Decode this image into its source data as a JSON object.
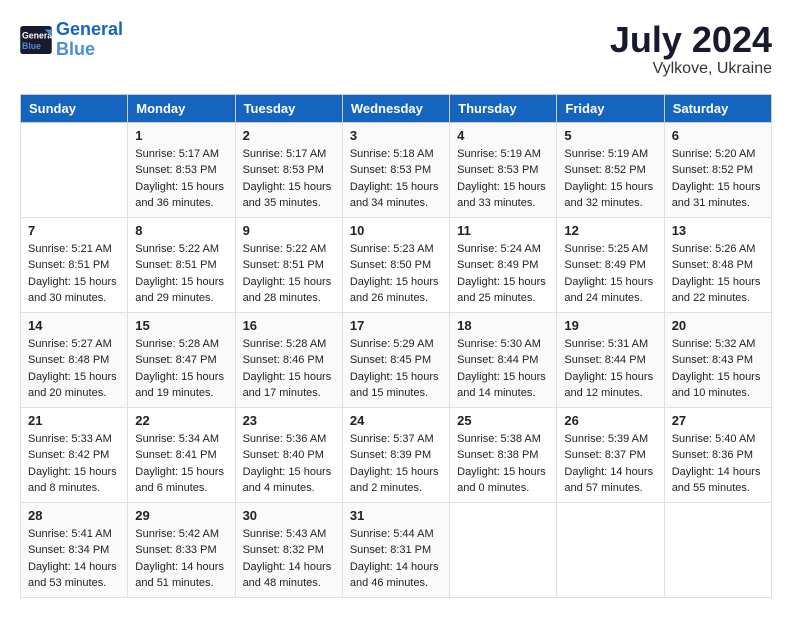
{
  "header": {
    "logo_line1": "General",
    "logo_line2": "Blue",
    "month": "July 2024",
    "location": "Vylkove, Ukraine"
  },
  "weekdays": [
    "Sunday",
    "Monday",
    "Tuesday",
    "Wednesday",
    "Thursday",
    "Friday",
    "Saturday"
  ],
  "weeks": [
    [
      {
        "day": "",
        "sunrise": "",
        "sunset": "",
        "daylight": ""
      },
      {
        "day": "1",
        "sunrise": "Sunrise: 5:17 AM",
        "sunset": "Sunset: 8:53 PM",
        "daylight": "Daylight: 15 hours and 36 minutes."
      },
      {
        "day": "2",
        "sunrise": "Sunrise: 5:17 AM",
        "sunset": "Sunset: 8:53 PM",
        "daylight": "Daylight: 15 hours and 35 minutes."
      },
      {
        "day": "3",
        "sunrise": "Sunrise: 5:18 AM",
        "sunset": "Sunset: 8:53 PM",
        "daylight": "Daylight: 15 hours and 34 minutes."
      },
      {
        "day": "4",
        "sunrise": "Sunrise: 5:19 AM",
        "sunset": "Sunset: 8:53 PM",
        "daylight": "Daylight: 15 hours and 33 minutes."
      },
      {
        "day": "5",
        "sunrise": "Sunrise: 5:19 AM",
        "sunset": "Sunset: 8:52 PM",
        "daylight": "Daylight: 15 hours and 32 minutes."
      },
      {
        "day": "6",
        "sunrise": "Sunrise: 5:20 AM",
        "sunset": "Sunset: 8:52 PM",
        "daylight": "Daylight: 15 hours and 31 minutes."
      }
    ],
    [
      {
        "day": "7",
        "sunrise": "Sunrise: 5:21 AM",
        "sunset": "Sunset: 8:51 PM",
        "daylight": "Daylight: 15 hours and 30 minutes."
      },
      {
        "day": "8",
        "sunrise": "Sunrise: 5:22 AM",
        "sunset": "Sunset: 8:51 PM",
        "daylight": "Daylight: 15 hours and 29 minutes."
      },
      {
        "day": "9",
        "sunrise": "Sunrise: 5:22 AM",
        "sunset": "Sunset: 8:51 PM",
        "daylight": "Daylight: 15 hours and 28 minutes."
      },
      {
        "day": "10",
        "sunrise": "Sunrise: 5:23 AM",
        "sunset": "Sunset: 8:50 PM",
        "daylight": "Daylight: 15 hours and 26 minutes."
      },
      {
        "day": "11",
        "sunrise": "Sunrise: 5:24 AM",
        "sunset": "Sunset: 8:49 PM",
        "daylight": "Daylight: 15 hours and 25 minutes."
      },
      {
        "day": "12",
        "sunrise": "Sunrise: 5:25 AM",
        "sunset": "Sunset: 8:49 PM",
        "daylight": "Daylight: 15 hours and 24 minutes."
      },
      {
        "day": "13",
        "sunrise": "Sunrise: 5:26 AM",
        "sunset": "Sunset: 8:48 PM",
        "daylight": "Daylight: 15 hours and 22 minutes."
      }
    ],
    [
      {
        "day": "14",
        "sunrise": "Sunrise: 5:27 AM",
        "sunset": "Sunset: 8:48 PM",
        "daylight": "Daylight: 15 hours and 20 minutes."
      },
      {
        "day": "15",
        "sunrise": "Sunrise: 5:28 AM",
        "sunset": "Sunset: 8:47 PM",
        "daylight": "Daylight: 15 hours and 19 minutes."
      },
      {
        "day": "16",
        "sunrise": "Sunrise: 5:28 AM",
        "sunset": "Sunset: 8:46 PM",
        "daylight": "Daylight: 15 hours and 17 minutes."
      },
      {
        "day": "17",
        "sunrise": "Sunrise: 5:29 AM",
        "sunset": "Sunset: 8:45 PM",
        "daylight": "Daylight: 15 hours and 15 minutes."
      },
      {
        "day": "18",
        "sunrise": "Sunrise: 5:30 AM",
        "sunset": "Sunset: 8:44 PM",
        "daylight": "Daylight: 15 hours and 14 minutes."
      },
      {
        "day": "19",
        "sunrise": "Sunrise: 5:31 AM",
        "sunset": "Sunset: 8:44 PM",
        "daylight": "Daylight: 15 hours and 12 minutes."
      },
      {
        "day": "20",
        "sunrise": "Sunrise: 5:32 AM",
        "sunset": "Sunset: 8:43 PM",
        "daylight": "Daylight: 15 hours and 10 minutes."
      }
    ],
    [
      {
        "day": "21",
        "sunrise": "Sunrise: 5:33 AM",
        "sunset": "Sunset: 8:42 PM",
        "daylight": "Daylight: 15 hours and 8 minutes."
      },
      {
        "day": "22",
        "sunrise": "Sunrise: 5:34 AM",
        "sunset": "Sunset: 8:41 PM",
        "daylight": "Daylight: 15 hours and 6 minutes."
      },
      {
        "day": "23",
        "sunrise": "Sunrise: 5:36 AM",
        "sunset": "Sunset: 8:40 PM",
        "daylight": "Daylight: 15 hours and 4 minutes."
      },
      {
        "day": "24",
        "sunrise": "Sunrise: 5:37 AM",
        "sunset": "Sunset: 8:39 PM",
        "daylight": "Daylight: 15 hours and 2 minutes."
      },
      {
        "day": "25",
        "sunrise": "Sunrise: 5:38 AM",
        "sunset": "Sunset: 8:38 PM",
        "daylight": "Daylight: 15 hours and 0 minutes."
      },
      {
        "day": "26",
        "sunrise": "Sunrise: 5:39 AM",
        "sunset": "Sunset: 8:37 PM",
        "daylight": "Daylight: 14 hours and 57 minutes."
      },
      {
        "day": "27",
        "sunrise": "Sunrise: 5:40 AM",
        "sunset": "Sunset: 8:36 PM",
        "daylight": "Daylight: 14 hours and 55 minutes."
      }
    ],
    [
      {
        "day": "28",
        "sunrise": "Sunrise: 5:41 AM",
        "sunset": "Sunset: 8:34 PM",
        "daylight": "Daylight: 14 hours and 53 minutes."
      },
      {
        "day": "29",
        "sunrise": "Sunrise: 5:42 AM",
        "sunset": "Sunset: 8:33 PM",
        "daylight": "Daylight: 14 hours and 51 minutes."
      },
      {
        "day": "30",
        "sunrise": "Sunrise: 5:43 AM",
        "sunset": "Sunset: 8:32 PM",
        "daylight": "Daylight: 14 hours and 48 minutes."
      },
      {
        "day": "31",
        "sunrise": "Sunrise: 5:44 AM",
        "sunset": "Sunset: 8:31 PM",
        "daylight": "Daylight: 14 hours and 46 minutes."
      },
      {
        "day": "",
        "sunrise": "",
        "sunset": "",
        "daylight": ""
      },
      {
        "day": "",
        "sunrise": "",
        "sunset": "",
        "daylight": ""
      },
      {
        "day": "",
        "sunrise": "",
        "sunset": "",
        "daylight": ""
      }
    ]
  ]
}
